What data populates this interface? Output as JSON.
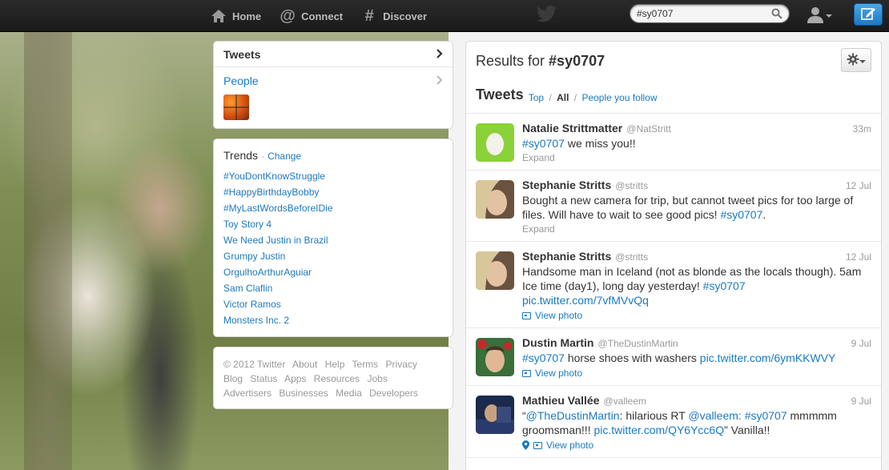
{
  "topbar": {
    "nav": [
      {
        "label": "Home",
        "icon": "home-icon"
      },
      {
        "label": "Connect",
        "icon": "at-icon"
      },
      {
        "label": "Discover",
        "icon": "hash-icon"
      }
    ],
    "search_value": "#sy0707"
  },
  "sidebar": {
    "filters": [
      {
        "label": "Tweets",
        "active": true
      },
      {
        "label": "People",
        "active": false
      }
    ],
    "trends": {
      "title": "Trends",
      "separator": "·",
      "change_label": "Change",
      "items": [
        "#YouDontKnowStruggle",
        "#HappyBirthdayBobby",
        "#MyLastWordsBeforeIDie",
        "Toy Story 4",
        "We Need Justin in Brazil",
        "Grumpy Justin",
        "OrgulhoArthurAguiar",
        "Sam Claflin",
        "Victor Ramos",
        "Monsters Inc. 2"
      ]
    },
    "footer": {
      "line1": [
        "© 2012 Twitter",
        "About",
        "Help",
        "Terms",
        "Privacy"
      ],
      "line2": [
        "Blog",
        "Status",
        "Apps",
        "Resources",
        "Jobs"
      ],
      "line3": [
        "Advertisers",
        "Businesses",
        "Media",
        "Developers"
      ]
    }
  },
  "main": {
    "results_prefix": "Results for",
    "results_query": "#sy0707",
    "tweets_title": "Tweets",
    "tabs": {
      "top": "Top",
      "sep1": "/",
      "all": "All",
      "sep2": "/",
      "follow": "People you follow"
    },
    "tweets": [
      {
        "name": "Natalie Strittmatter",
        "handle": "@NatStritt",
        "time": "33m",
        "text_link": "#sy0707",
        "text": " we miss you!!",
        "action": "Expand"
      },
      {
        "name": "Stephanie Stritts",
        "handle": "@stritts",
        "time": "12 Jul",
        "text": "Bought a new camera for trip, but cannot tweet pics for too large of files. Will have to wait to see good pics! ",
        "text_link": "#sy0707",
        "text_end": ".",
        "action": "Expand"
      },
      {
        "name": "Stephanie Stritts",
        "handle": "@stritts",
        "time": "12 Jul",
        "text": "Handsome man in Iceland (not as blonde as the locals though). 5am Ice time (day1), long day yesterday! ",
        "text_link": "#sy0707",
        "url": "pic.twitter.com/7vfMVvQq",
        "action": "View photo"
      },
      {
        "name": "Dustin Martin",
        "handle": "@TheDustinMartin",
        "time": "9 Jul",
        "text_link": "#sy0707",
        "text": " horse shoes with washers ",
        "url": "pic.twitter.com/6ymKKWVY",
        "action": "View photo"
      },
      {
        "name": "Mathieu Vallée",
        "handle": "@valleem",
        "time": "9 Jul",
        "quote_open": "“",
        "mention1": "@TheDustinMartin",
        "text_a": ": hilarious RT ",
        "mention2": "@valleem",
        "colon": ":",
        "space": " ",
        "hashtag": "#sy0707",
        "text_b": " mmmmm groomsman!!! ",
        "url": "pic.twitter.com/QY6Ycc6Q",
        "text_c": "” Vanilla!!",
        "action": "View photo"
      }
    ]
  },
  "colors": {
    "link": "#1a7ac0",
    "compose": "#1f78c4",
    "topbar": "#1f1f1f"
  }
}
